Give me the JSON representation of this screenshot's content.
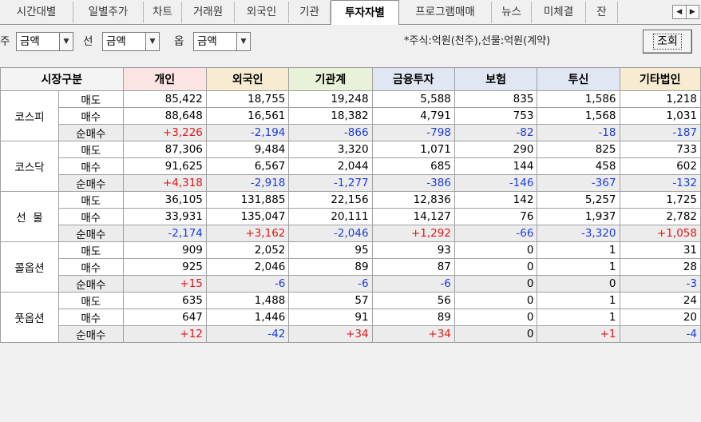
{
  "tabs": [
    "시간대별",
    "일별주가",
    "차트",
    "거래원",
    "외국인",
    "기관",
    "투자자별",
    "프로그램매매",
    "뉴스",
    "미체결",
    "잔"
  ],
  "active_tab": "투자자별",
  "filters": {
    "f1_label": "주",
    "f1_value": "금액",
    "f2_label": "선",
    "f2_value": "금액",
    "f3_label": "옵",
    "f3_value": "금액",
    "note": "*주식:억원(천주),선물:억원(계약)",
    "query_label": "조회"
  },
  "table": {
    "corner": "시장구분",
    "columns": [
      "개인",
      "외국인",
      "기관계",
      "금융투자",
      "보험",
      "투신",
      "기타법인"
    ],
    "column_colors": [
      "#fde4e4",
      "#f7ecd2",
      "#e8f2d8",
      "#e0e6f2",
      "#e0e6f2",
      "#e0e6f2",
      "#f7ecd2"
    ],
    "groups": [
      {
        "name": "코스피",
        "rows": [
          {
            "label": "매도",
            "values": [
              "85,422",
              "18,755",
              "19,248",
              "5,588",
              "835",
              "1,586",
              "1,218"
            ]
          },
          {
            "label": "매수",
            "values": [
              "88,648",
              "16,561",
              "18,382",
              "4,791",
              "753",
              "1,568",
              "1,031"
            ]
          },
          {
            "label": "순매수",
            "values": [
              "+3,226",
              "-2,194",
              "-866",
              "-798",
              "-82",
              "-18",
              "-187"
            ]
          }
        ]
      },
      {
        "name": "코스닥",
        "rows": [
          {
            "label": "매도",
            "values": [
              "87,306",
              "9,484",
              "3,320",
              "1,071",
              "290",
              "825",
              "733"
            ]
          },
          {
            "label": "매수",
            "values": [
              "91,625",
              "6,567",
              "2,044",
              "685",
              "144",
              "458",
              "602"
            ]
          },
          {
            "label": "순매수",
            "values": [
              "+4,318",
              "-2,918",
              "-1,277",
              "-386",
              "-146",
              "-367",
              "-132"
            ]
          }
        ]
      },
      {
        "name": "선  물",
        "rows": [
          {
            "label": "매도",
            "values": [
              "36,105",
              "131,885",
              "22,156",
              "12,836",
              "142",
              "5,257",
              "1,725"
            ]
          },
          {
            "label": "매수",
            "values": [
              "33,931",
              "135,047",
              "20,111",
              "14,127",
              "76",
              "1,937",
              "2,782"
            ]
          },
          {
            "label": "순매수",
            "values": [
              "-2,174",
              "+3,162",
              "-2,046",
              "+1,292",
              "-66",
              "-3,320",
              "+1,058"
            ]
          }
        ]
      },
      {
        "name": "콜옵션",
        "rows": [
          {
            "label": "매도",
            "values": [
              "909",
              "2,052",
              "95",
              "93",
              "0",
              "1",
              "31"
            ]
          },
          {
            "label": "매수",
            "values": [
              "925",
              "2,046",
              "89",
              "87",
              "0",
              "1",
              "28"
            ]
          },
          {
            "label": "순매수",
            "values": [
              "+15",
              "-6",
              "-6",
              "-6",
              "0",
              "0",
              "-3"
            ]
          }
        ]
      },
      {
        "name": "풋옵션",
        "rows": [
          {
            "label": "매도",
            "values": [
              "635",
              "1,488",
              "57",
              "56",
              "0",
              "1",
              "24"
            ]
          },
          {
            "label": "매수",
            "values": [
              "647",
              "1,446",
              "91",
              "89",
              "0",
              "1",
              "20"
            ]
          },
          {
            "label": "순매수",
            "values": [
              "+12",
              "-42",
              "+34",
              "+34",
              "0",
              "+1",
              "-4"
            ]
          }
        ]
      }
    ]
  }
}
